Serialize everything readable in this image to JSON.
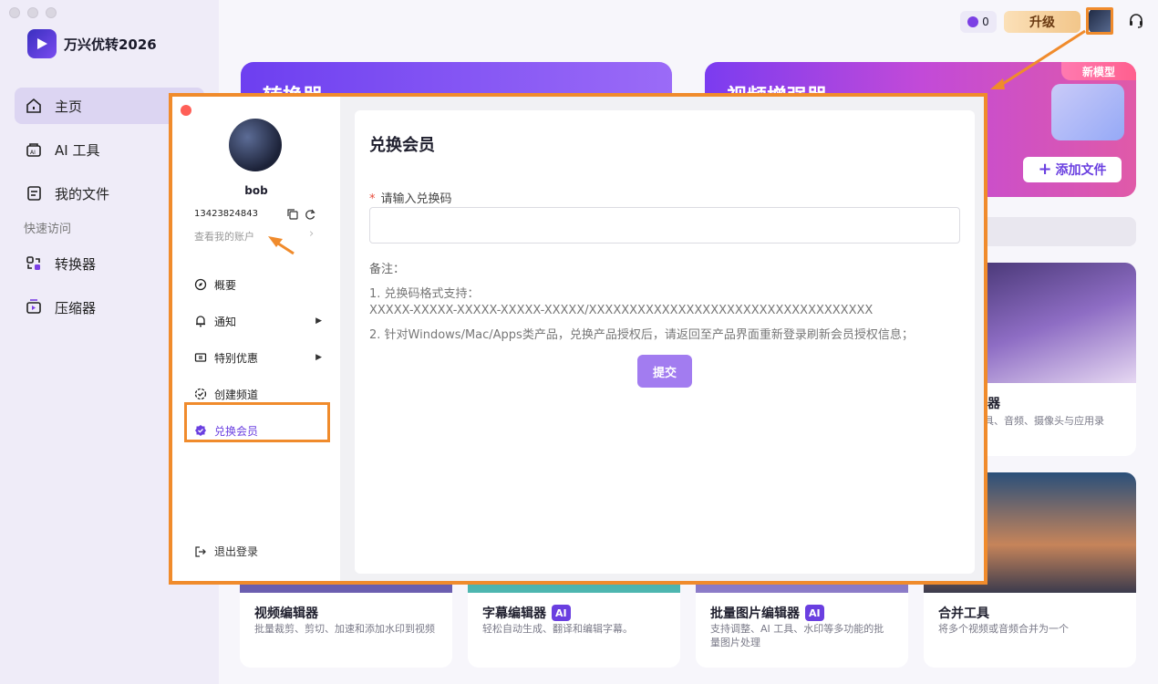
{
  "app": {
    "title": "万兴优转2026"
  },
  "sidebar": {
    "items": [
      {
        "label": "主页",
        "icon": "home-icon"
      },
      {
        "label": "AI 工具",
        "icon": "ai-tools-icon"
      },
      {
        "label": "我的文件",
        "icon": "file-icon"
      }
    ],
    "quick_access_label": "快速访问",
    "quick_items": [
      {
        "label": "转换器",
        "icon": "converter-icon"
      },
      {
        "label": "压缩器",
        "icon": "compressor-icon"
      }
    ]
  },
  "topbar": {
    "coin_count": "0",
    "upgrade_label": "升级"
  },
  "banners": {
    "left_title": "转换器",
    "right_title": "视频增强器",
    "right_badge": "新模型",
    "add_file_label": "添加文件"
  },
  "tools": [
    {
      "name": "视频编辑器",
      "desc": "批量裁剪、剪切、加速和添加水印到视频",
      "ai": false
    },
    {
      "name": "字幕编辑器",
      "desc": "轻松自动生成、翻译和编辑字幕。",
      "ai": true
    },
    {
      "name": "批量图片编辑器",
      "desc": "支持调整、AI 工具、水印等多功能的批量图片处理",
      "ai": true
    },
    {
      "name": "合并工具",
      "desc": "将多个视频或音频合并为一个",
      "ai": false
    }
  ],
  "recorder_card": {
    "name_tail": "器",
    "desc_tail": "具、音频、摄像头与应用录"
  },
  "ai_tag": "AI",
  "modal": {
    "user_name": "bob",
    "phone": "13423824843",
    "view_account": "查看我的账户",
    "menu": [
      {
        "label": "概要",
        "icon": "compass-icon",
        "has_arrow": false
      },
      {
        "label": "通知",
        "icon": "bell-icon",
        "has_arrow": true
      },
      {
        "label": "特别优惠",
        "icon": "ticket-icon",
        "has_arrow": true
      },
      {
        "label": "创建频道",
        "icon": "channel-icon",
        "has_arrow": false
      },
      {
        "label": "兑换会员",
        "icon": "badge-icon",
        "has_arrow": false,
        "active": true
      }
    ],
    "logout": "退出登录",
    "panel": {
      "title": "兑换会员",
      "field_label": "请输入兑换码",
      "required_mark": "*",
      "input_value": "",
      "note_title": "备注：",
      "note_1": "1. 兑换码格式支持：",
      "note_format": "XXXXX-XXXXX-XXXXX-XXXXX-XXXXX/XXXXXXXXXXXXXXXXXXXXXXXXXXXXXXXXXXX",
      "note_2": "2. 针对Windows/Mac/Apps类产品，兑换产品授权后，请返回至产品界面重新登录刷新会员授权信息；",
      "submit_label": "提交"
    }
  },
  "colors": {
    "accent": "#6a3fe0",
    "highlight": "#f08b2c",
    "submit": "#a27cf0"
  }
}
